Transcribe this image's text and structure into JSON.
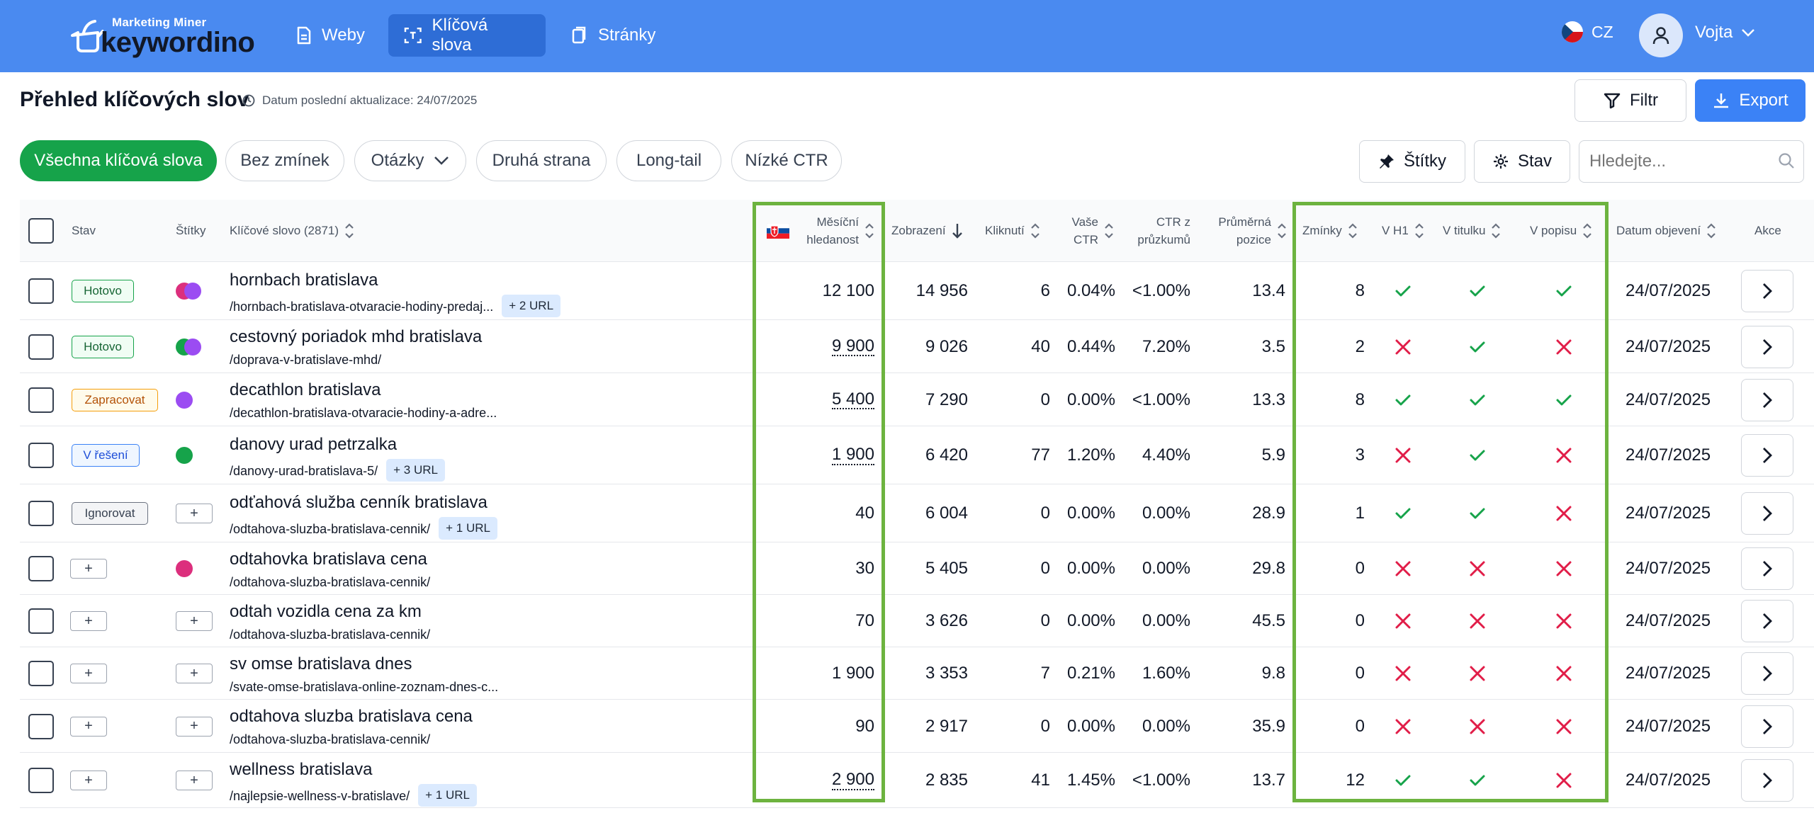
{
  "brand": {
    "top": "Marketing Miner",
    "name": "keywordino"
  },
  "nav": [
    {
      "label": "Weby",
      "icon": "document-icon"
    },
    {
      "label": "Klíčová slova",
      "icon": "keyword-scan-icon",
      "active": true
    },
    {
      "label": "Stránky",
      "icon": "pages-icon"
    }
  ],
  "lang": "CZ",
  "user": "Vojta",
  "page": {
    "title": "Přehled klíčových slov",
    "updated": "Datum poslední aktualizace: 24/07/2025"
  },
  "buttons": {
    "filter": "Filtr",
    "export": "Export",
    "tags": "Štítky",
    "state": "Stav"
  },
  "search": {
    "placeholder": "Hledejte..."
  },
  "filters": [
    "Všechna klíčová slova",
    "Bez zmínek",
    "Otázky",
    "Druhá strana",
    "Long-tail",
    "Nízké CTR"
  ],
  "columns": {
    "stav": "Stav",
    "stitky": "Štítky",
    "keyword": "Klíčové slovo (2871)",
    "search_vol_1": "Měsíční",
    "search_vol_2": "hledanost",
    "impressions": "Zobrazení",
    "clicks": "Kliknutí",
    "ctr_1": "Vaše",
    "ctr_2": "CTR",
    "ctr_survey_1": "CTR z",
    "ctr_survey_2": "průzkumů",
    "avg_pos_1": "Průměrná",
    "avg_pos_2": "pozice",
    "mentions": "Zmínky",
    "in_h1": "V H1",
    "in_title": "V titulku",
    "in_desc": "V popisu",
    "discovered": "Datum objevení",
    "actions": "Akce"
  },
  "status_colors": {
    "Hotovo": "green",
    "Zapracovat": "orange",
    "V řešení": "blue",
    "Ignorovat": "gray"
  },
  "rows": [
    {
      "status": "Hotovo",
      "tags": [
        "#dc2f7d",
        "#9b4cf2"
      ],
      "keyword": "hornbach bratislava",
      "url": "/hornbach-bratislava-otvaracie-hodiny-predaj...",
      "extra": "+ 2 URL",
      "volume": "12 100",
      "vol_dotted": false,
      "impressions": "14 956",
      "clicks": "6",
      "ctr": "0.04%",
      "ctr_survey": "<1.00%",
      "avg_pos": "13.4",
      "mentions": "8",
      "h1": true,
      "title": true,
      "desc": true,
      "date": "24/07/2025"
    },
    {
      "status": "Hotovo",
      "tags": [
        "#16a34a",
        "#9b4cf2"
      ],
      "keyword": "cestovný poriadok mhd bratislava",
      "url": "/doprava-v-bratislave-mhd/",
      "extra": "",
      "volume": "9 900",
      "vol_dotted": true,
      "impressions": "9 026",
      "clicks": "40",
      "ctr": "0.44%",
      "ctr_survey": "7.20%",
      "avg_pos": "3.5",
      "mentions": "2",
      "h1": false,
      "title": true,
      "desc": false,
      "date": "24/07/2025"
    },
    {
      "status": "Zapracovat",
      "tags": [
        "#9b4cf2"
      ],
      "keyword": "decathlon bratislava",
      "url": "/decathlon-bratislava-otvaracie-hodiny-a-adre...",
      "extra": "",
      "volume": "5 400",
      "vol_dotted": true,
      "impressions": "7 290",
      "clicks": "0",
      "ctr": "0.00%",
      "ctr_survey": "<1.00%",
      "avg_pos": "13.3",
      "mentions": "8",
      "h1": true,
      "title": true,
      "desc": true,
      "date": "24/07/2025"
    },
    {
      "status": "V řešení",
      "tags": [
        "#16a34a"
      ],
      "keyword": "danovy urad petrzalka",
      "url": "/danovy-urad-bratislava-5/",
      "extra": "+ 3 URL",
      "volume": "1 900",
      "vol_dotted": true,
      "impressions": "6 420",
      "clicks": "77",
      "ctr": "1.20%",
      "ctr_survey": "4.40%",
      "avg_pos": "5.9",
      "mentions": "3",
      "h1": false,
      "title": true,
      "desc": false,
      "date": "24/07/2025"
    },
    {
      "status": "Ignorovat",
      "tags": [],
      "keyword": "odťahová služba cenník bratislava",
      "url": "/odtahova-sluzba-bratislava-cennik/",
      "extra": "+ 1 URL",
      "volume": "40",
      "vol_dotted": false,
      "impressions": "6 004",
      "clicks": "0",
      "ctr": "0.00%",
      "ctr_survey": "0.00%",
      "avg_pos": "28.9",
      "mentions": "1",
      "h1": true,
      "title": true,
      "desc": false,
      "date": "24/07/2025"
    },
    {
      "status": "",
      "tags": [
        "#dc2f7d"
      ],
      "keyword": "odtahovka bratislava cena",
      "url": "/odtahova-sluzba-bratislava-cennik/",
      "extra": "",
      "volume": "30",
      "vol_dotted": false,
      "impressions": "5 405",
      "clicks": "0",
      "ctr": "0.00%",
      "ctr_survey": "0.00%",
      "avg_pos": "29.8",
      "mentions": "0",
      "h1": false,
      "title": false,
      "desc": false,
      "date": "24/07/2025"
    },
    {
      "status": "",
      "tags": [],
      "keyword": "odtah vozidla cena za km",
      "url": "/odtahova-sluzba-bratislava-cennik/",
      "extra": "",
      "volume": "70",
      "vol_dotted": false,
      "impressions": "3 626",
      "clicks": "0",
      "ctr": "0.00%",
      "ctr_survey": "0.00%",
      "avg_pos": "45.5",
      "mentions": "0",
      "h1": false,
      "title": false,
      "desc": false,
      "date": "24/07/2025"
    },
    {
      "status": "",
      "tags": [],
      "keyword": "sv omse bratislava dnes",
      "url": "/svate-omse-bratislava-online-zoznam-dnes-c...",
      "extra": "",
      "volume": "1 900",
      "vol_dotted": false,
      "impressions": "3 353",
      "clicks": "7",
      "ctr": "0.21%",
      "ctr_survey": "1.60%",
      "avg_pos": "9.8",
      "mentions": "0",
      "h1": false,
      "title": false,
      "desc": false,
      "date": "24/07/2025"
    },
    {
      "status": "",
      "tags": [],
      "keyword": "odtahova sluzba bratislava cena",
      "url": "/odtahova-sluzba-bratislava-cennik/",
      "extra": "",
      "volume": "90",
      "vol_dotted": false,
      "impressions": "2 917",
      "clicks": "0",
      "ctr": "0.00%",
      "ctr_survey": "0.00%",
      "avg_pos": "35.9",
      "mentions": "0",
      "h1": false,
      "title": false,
      "desc": false,
      "date": "24/07/2025"
    },
    {
      "status": "",
      "tags": [],
      "keyword": "wellness bratislava",
      "url": "/najlepsie-wellness-v-bratislave/",
      "extra": "+ 1 URL",
      "volume": "2 900",
      "vol_dotted": true,
      "impressions": "2 835",
      "clicks": "41",
      "ctr": "1.45%",
      "ctr_survey": "<1.00%",
      "avg_pos": "13.7",
      "mentions": "12",
      "h1": true,
      "title": true,
      "desc": false,
      "date": "24/07/2025"
    }
  ],
  "colors": {
    "header": "#4a8af0",
    "active_filter": "#16a34a",
    "check": "#16a34a",
    "cross": "#e11d48",
    "highlight": "#6db33f"
  }
}
